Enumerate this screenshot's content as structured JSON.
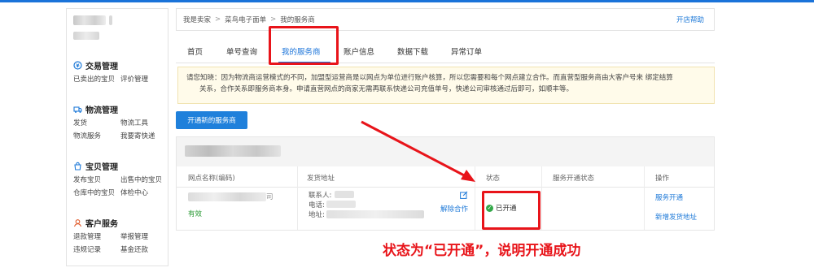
{
  "sidebar": {
    "sections": [
      {
        "title": "交易管理",
        "icon": "transaction-icon",
        "links": [
          "已卖出的宝贝",
          "评价管理"
        ]
      },
      {
        "title": "物流管理",
        "icon": "logistics-icon",
        "links": [
          "发货",
          "物流工具",
          "物流服务",
          "我要寄快递"
        ]
      },
      {
        "title": "宝贝管理",
        "icon": "goods-icon",
        "links": [
          "发布宝贝",
          "出售中的宝贝",
          "仓库中的宝贝",
          "体检中心"
        ]
      },
      {
        "title": "客户服务",
        "icon": "customer-service-icon",
        "links": [
          "退款管理",
          "举报管理",
          "违规记录",
          "基金还款"
        ]
      }
    ]
  },
  "breadcrumb": {
    "items": [
      "我是卖家",
      "菜鸟电子面单",
      "我的服务商"
    ],
    "help": "开店帮助"
  },
  "tabs": [
    "首页",
    "单号查询",
    "我的服务商",
    "账户信息",
    "数据下载",
    "异常订单"
  ],
  "active_tab": "我的服务商",
  "notice": {
    "line1": "请您知晓：因为物流商运营模式的不同，加盟型运营商是以网点为单位进行账户核算，所以您需要和每个网点建立合作。而直营型服务商由大客户号来 绑定结算",
    "line2": "关系，合作关系即服务商本身。申请直营网点的商家无需再联系快递公司充值单号，快递公司审核通过后即可，如顺丰等。"
  },
  "open_button": "开通新的服务商",
  "table": {
    "headers": [
      "网点名称(编码)",
      "发货地址",
      "状态",
      "服务开通状态",
      "操作"
    ],
    "row": {
      "name_suffix": "司",
      "validity": "有效",
      "contact_label": "联系人:",
      "phone_label": "电话:",
      "address_label": "地址:",
      "unbind": "解除合作",
      "status": "已开通",
      "op_service": "服务开通",
      "op_add_address": "新增发货地址"
    }
  },
  "annotation": "状态为“已开通”，说明开通成功",
  "colors": {
    "accent": "#1a73d9",
    "highlight": "#e8141a",
    "success": "#33a849"
  }
}
